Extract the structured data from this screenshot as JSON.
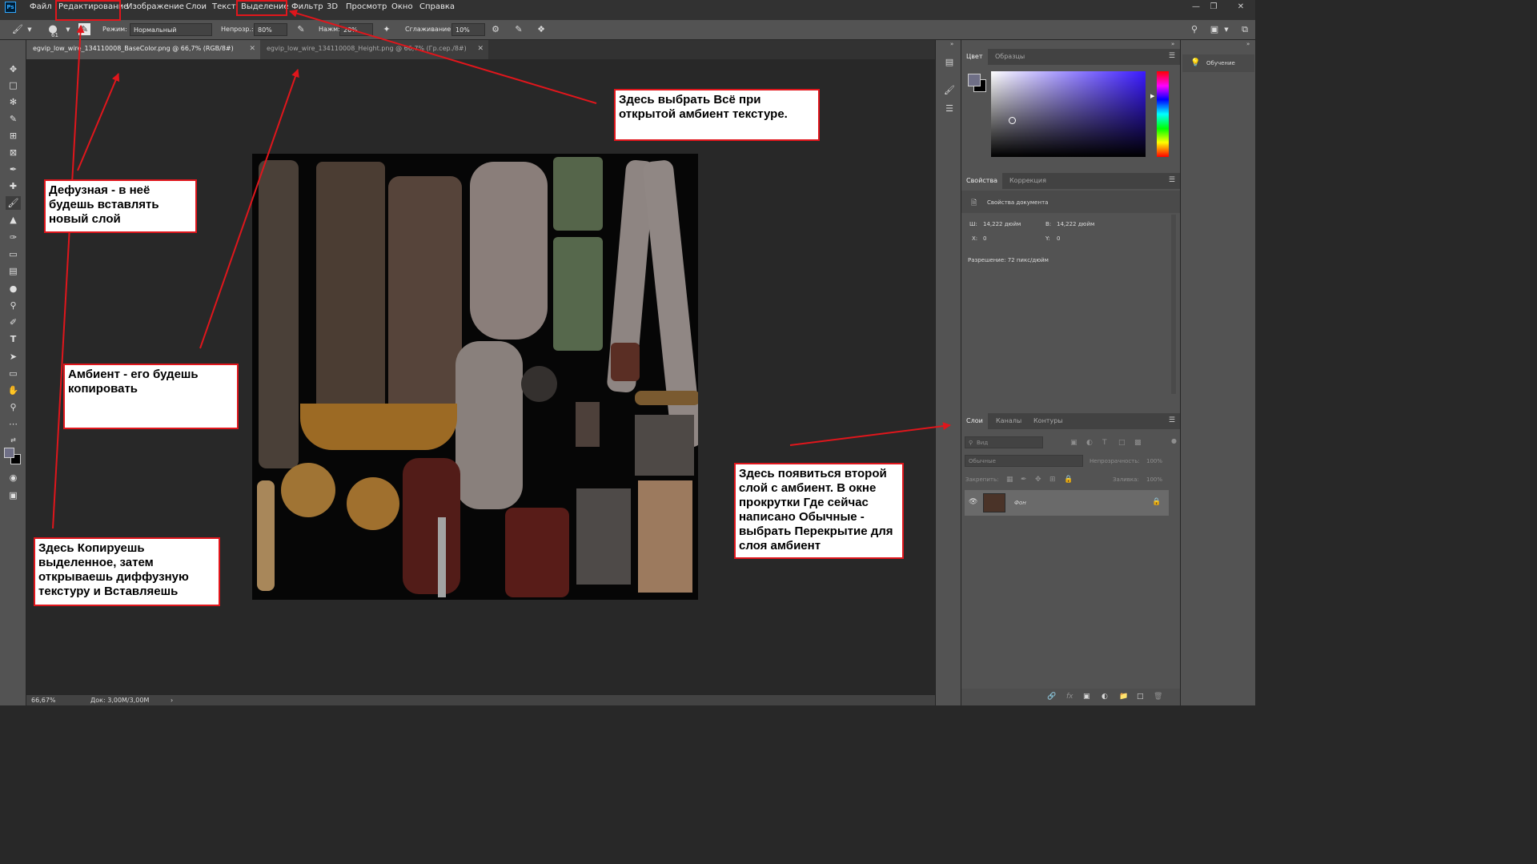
{
  "app": {
    "logo": "Ps"
  },
  "menu": [
    "Файл",
    "Редактирование",
    "Изображение",
    "Слои",
    "Текст",
    "Выделение",
    "Фильтр",
    "3D",
    "Просмотр",
    "Окно",
    "Справка"
  ],
  "options_bar": {
    "brush_size": "61",
    "mode_label": "Режим:",
    "mode_value": "Нормальный",
    "opacity_label": "Непрозр.:",
    "opacity_value": "80%",
    "pressure_label": "Нажм:",
    "pressure_value": "20%",
    "smoothing_label": "Сглаживание:",
    "smoothing_value": "10%"
  },
  "tabs": [
    {
      "label": "egvip_low_wire_134110008_BaseColor.png @ 66,7% (RGB/8#)",
      "active": true
    },
    {
      "label": "egvip_low_wire_134110008_Height.png @ 66,7% (Гр.сер./8#)",
      "active": false
    }
  ],
  "status": {
    "zoom": "66,67%",
    "doc": "Док: 3,00M/3,00M"
  },
  "color_panel": {
    "tabs": [
      "Цвет",
      "Образцы"
    ]
  },
  "properties_panel": {
    "tabs": [
      "Свойства",
      "Коррекция"
    ],
    "doc_props": "Свойства документа",
    "width_label": "Ш:",
    "width_value": "14,222 дюйм",
    "height_label": "В:",
    "height_value": "14,222 дюйм",
    "x_label": "X:",
    "x_value": "0",
    "y_label": "Y:",
    "y_value": "0",
    "resolution": "Разрешение: 72 пикс/дюйм"
  },
  "layers_panel": {
    "tabs": [
      "Слои",
      "Каналы",
      "Контуры"
    ],
    "search_placeholder": "Вид",
    "blend_mode": "Обычные",
    "opacity_label": "Непрозрачность:",
    "opacity_value": "100%",
    "lock_label": "Закрепить:",
    "fill_label": "Заливка:",
    "fill_value": "100%",
    "layer_name": "Фон"
  },
  "learn_panel": {
    "label": "Обучение"
  },
  "annotations": {
    "select_all": "Здесь выбрать Всё при открытой амбиент текстуре.",
    "diffuse": "Дефузная - в неё будешь вставлять новый слой",
    "ambient": "Амбиент - его будешь копировать",
    "copy": "Здесь Копируешь выделенное, затем открываешь диффузную текстуру и Вставляешь",
    "second_layer": "Здесь появиться второй слой с амбиент. В окне прокрутки Где сейчас написано Обычные - выбрать Перекрытие для слоя амбиент"
  },
  "colors": {
    "annotation_red": "#e0161c",
    "panel_bg": "#535353",
    "workspace_bg": "#282828"
  },
  "icons": {
    "tools": [
      "move-icon",
      "marquee-icon",
      "lasso-icon",
      "quick-select-icon",
      "crop-icon",
      "frame-icon",
      "eyedropper-icon",
      "healing-icon",
      "brush-icon",
      "stamp-icon",
      "history-brush-icon",
      "eraser-icon",
      "gradient-icon",
      "blur-icon",
      "dodge-icon",
      "pen-icon",
      "type-icon",
      "path-select-icon",
      "rectangle-icon",
      "hand-icon",
      "zoom-icon",
      "more-tools-icon"
    ]
  }
}
